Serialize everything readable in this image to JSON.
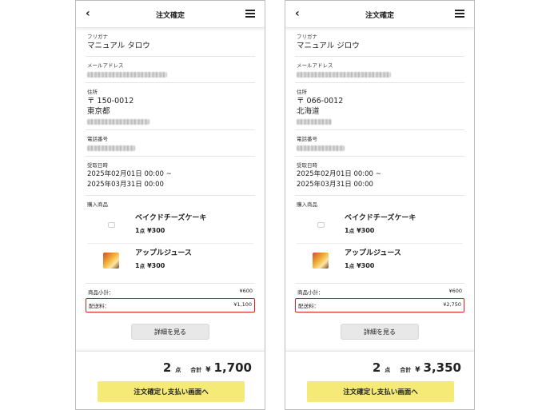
{
  "left": {
    "header": {
      "back": "‹",
      "title": "注文確定"
    },
    "furigana": {
      "label": "フリガナ",
      "value": "マニュアル タロウ"
    },
    "email": {
      "label": "メールアドレス"
    },
    "address": {
      "label": "住所",
      "postal": "〒 150-0012",
      "prefecture": "東京都"
    },
    "phone": {
      "label": "電話番号"
    },
    "pickup": {
      "label": "受取日時",
      "start": "2025年02月01日 00:00 ~",
      "end": "2025年03月31日 00:00"
    },
    "products": {
      "label": "購入商品",
      "items": [
        {
          "name": "ベイクドチーズケーキ",
          "qty": "1",
          "qty_unit": "点",
          "price": "¥300"
        },
        {
          "name": "アップルジュース",
          "qty": "1",
          "qty_unit": "点",
          "price": "¥300"
        }
      ]
    },
    "summary": {
      "subtotal_label": "商品小計：",
      "subtotal": "¥600",
      "shipping_label": "配送料：",
      "shipping": "¥1,100"
    },
    "detail_button": "詳細を見る",
    "footer": {
      "count": "2",
      "count_unit": "点",
      "total_label": "合計",
      "currency": "¥",
      "total": "1,700"
    },
    "submit_button": "注文確定し支払い画面へ"
  },
  "right": {
    "header": {
      "back": "‹",
      "title": "注文確定"
    },
    "furigana": {
      "label": "フリガナ",
      "value": "マニュアル ジロウ"
    },
    "email": {
      "label": "メールアドレス"
    },
    "address": {
      "label": "住所",
      "postal": "〒 066-0012",
      "prefecture": "北海道"
    },
    "phone": {
      "label": "電話番号"
    },
    "pickup": {
      "label": "受取日時",
      "start": "2025年02月01日 00:00 ~",
      "end": "2025年03月31日 00:00"
    },
    "products": {
      "label": "購入商品",
      "items": [
        {
          "name": "ベイクドチーズケーキ",
          "qty": "1",
          "qty_unit": "点",
          "price": "¥300"
        },
        {
          "name": "アップルジュース",
          "qty": "1",
          "qty_unit": "点",
          "price": "¥300"
        }
      ]
    },
    "summary": {
      "subtotal_label": "商品小計：",
      "subtotal": "¥600",
      "shipping_label": "配送料：",
      "shipping": "¥2,750"
    },
    "detail_button": "詳細を見る",
    "footer": {
      "count": "2",
      "count_unit": "点",
      "total_label": "合計",
      "currency": "¥",
      "total": "3,350"
    },
    "submit_button": "注文確定し支払い画面へ"
  },
  "colors": {
    "submit_button_bg": "#f4ea75",
    "highlight_border": "#e02020",
    "detail_button_bg": "#e8e8e8"
  },
  "icons": {
    "back": "chevron-left-icon",
    "menu": "hamburger-menu-icon"
  }
}
